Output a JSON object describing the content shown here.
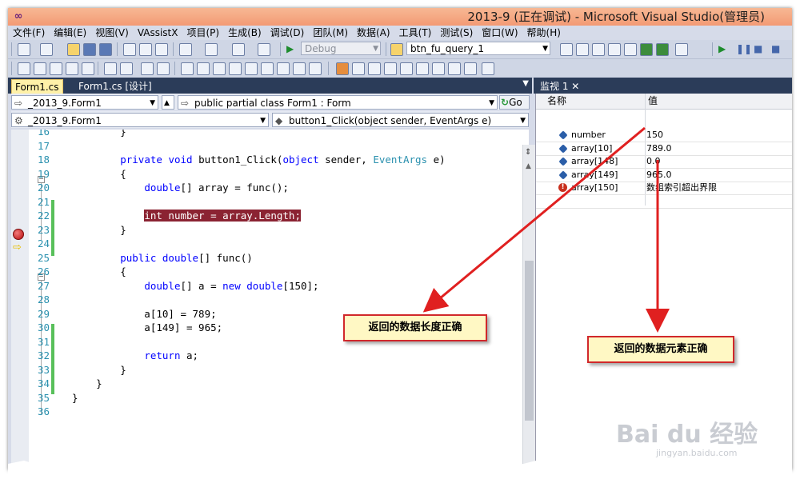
{
  "window": {
    "title": "2013-9 (正在调试) - Microsoft Visual Studio(管理员)",
    "logo_icon": "vs-infinity-icon"
  },
  "menu": [
    "文件(F)",
    "编辑(E)",
    "视图(V)",
    "VAssistX",
    "项目(P)",
    "生成(B)",
    "调试(D)",
    "团队(M)",
    "数据(A)",
    "工具(T)",
    "测试(S)",
    "窗口(W)",
    "帮助(H)"
  ],
  "toolbar": {
    "config_combo": "Debug",
    "find_combo": "btn_fu_query_1"
  },
  "editor_tabs": [
    {
      "label": "Form1.cs",
      "active": true
    },
    {
      "label": "Form1.cs [设计]",
      "active": false
    }
  ],
  "watch_tab": "监视 1",
  "nav": {
    "class_combo": "_2013_9.Form1",
    "member_combo": "public partial class Form1 : Form",
    "go_label": "Go",
    "namespace_combo": "_2013_9.Form1",
    "method_combo": "button1_Click(object sender, EventArgs e)"
  },
  "code_lines": [
    {
      "n": "16",
      "parts": [
        {
          "t": "        }",
          "c": ""
        }
      ]
    },
    {
      "n": "17",
      "parts": []
    },
    {
      "n": "18",
      "parts": [
        {
          "t": "        ",
          "c": ""
        },
        {
          "t": "private",
          "c": "kw"
        },
        {
          "t": " ",
          "c": ""
        },
        {
          "t": "void",
          "c": "kw"
        },
        {
          "t": " button1_Click(",
          "c": ""
        },
        {
          "t": "object",
          "c": "kw"
        },
        {
          "t": " sender, ",
          "c": ""
        },
        {
          "t": "EventArgs",
          "c": "ty"
        },
        {
          "t": " e)",
          "c": ""
        }
      ]
    },
    {
      "n": "19",
      "parts": [
        {
          "t": "        {",
          "c": ""
        }
      ]
    },
    {
      "n": "20",
      "parts": [
        {
          "t": "            ",
          "c": ""
        },
        {
          "t": "double",
          "c": "kw"
        },
        {
          "t": "[] array = func();",
          "c": ""
        }
      ]
    },
    {
      "n": "21",
      "parts": []
    },
    {
      "n": "22",
      "parts": [
        {
          "t": "            ",
          "c": ""
        },
        {
          "t": "int number = array.Length;",
          "c": "hl"
        }
      ]
    },
    {
      "n": "23",
      "parts": [
        {
          "t": "        }",
          "c": ""
        }
      ]
    },
    {
      "n": "24",
      "parts": []
    },
    {
      "n": "25",
      "parts": [
        {
          "t": "        ",
          "c": ""
        },
        {
          "t": "public",
          "c": "kw"
        },
        {
          "t": " ",
          "c": ""
        },
        {
          "t": "double",
          "c": "kw"
        },
        {
          "t": "[] func()",
          "c": ""
        }
      ]
    },
    {
      "n": "26",
      "parts": [
        {
          "t": "        {",
          "c": ""
        }
      ]
    },
    {
      "n": "27",
      "parts": [
        {
          "t": "            ",
          "c": ""
        },
        {
          "t": "double",
          "c": "kw"
        },
        {
          "t": "[] a = ",
          "c": ""
        },
        {
          "t": "new",
          "c": "kw"
        },
        {
          "t": " ",
          "c": ""
        },
        {
          "t": "double",
          "c": "kw"
        },
        {
          "t": "[150];",
          "c": ""
        }
      ]
    },
    {
      "n": "28",
      "parts": []
    },
    {
      "n": "29",
      "parts": [
        {
          "t": "            a[10] = 789;",
          "c": ""
        }
      ]
    },
    {
      "n": "30",
      "parts": [
        {
          "t": "            a[149] = 965;",
          "c": ""
        }
      ]
    },
    {
      "n": "31",
      "parts": []
    },
    {
      "n": "32",
      "parts": [
        {
          "t": "            ",
          "c": ""
        },
        {
          "t": "return",
          "c": "kw"
        },
        {
          "t": " a;",
          "c": ""
        }
      ]
    },
    {
      "n": "33",
      "parts": [
        {
          "t": "        }",
          "c": ""
        }
      ]
    },
    {
      "n": "34",
      "parts": [
        {
          "t": "    }",
          "c": ""
        }
      ]
    },
    {
      "n": "35",
      "parts": [
        {
          "t": "}",
          "c": ""
        }
      ]
    },
    {
      "n": "36",
      "parts": []
    }
  ],
  "watch": {
    "col_name": "名称",
    "col_value": "值",
    "rows": [
      {
        "name": "number",
        "value": "150",
        "icon": "diamond-icon"
      },
      {
        "name": "array[10]",
        "value": "789.0",
        "icon": "diamond-icon"
      },
      {
        "name": "array[148]",
        "value": "0.0",
        "icon": "diamond-icon"
      },
      {
        "name": "array[149]",
        "value": "965.0",
        "icon": "diamond-icon"
      },
      {
        "name": "array[150]",
        "value": "数组索引超出界限",
        "icon": "error-icon"
      }
    ]
  },
  "annotations": {
    "length_note": "返回的数据长度正确",
    "element_note": "返回的数据元素正确",
    "arrow_color": "#e02020"
  },
  "watermark": {
    "logo": "Bai du 经验",
    "url": "jingyan.baidu.com"
  },
  "colors": {
    "titlebar": "#f39a74",
    "tab_strip": "#2b3c59",
    "active_tab": "#fff1a8",
    "highlight": "#8b2332",
    "keyword": "#0000ff",
    "type": "#2b91af"
  }
}
